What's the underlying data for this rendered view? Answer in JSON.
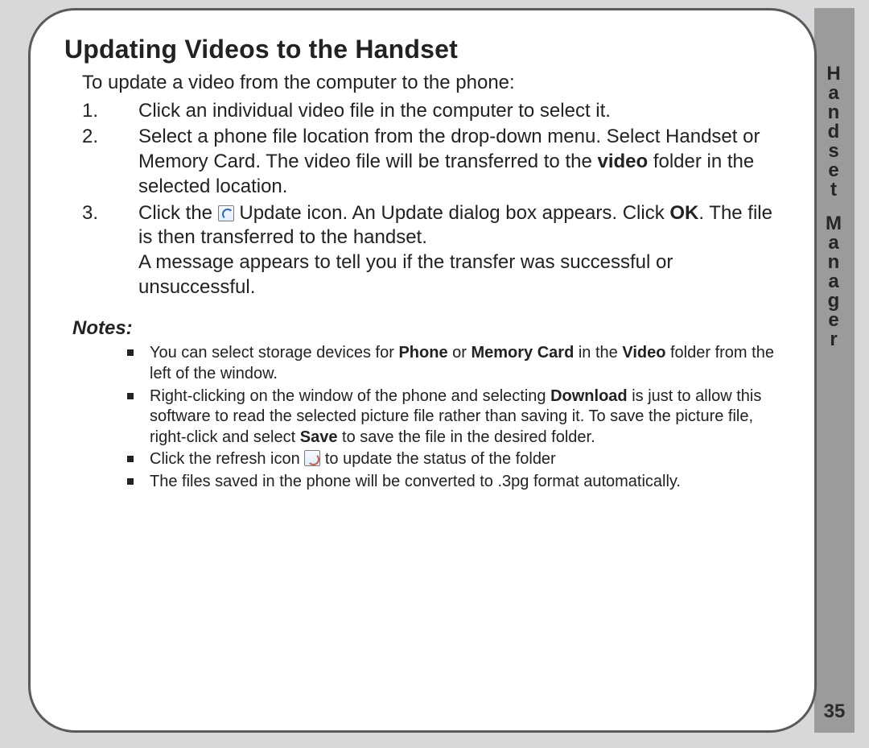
{
  "sideTab": {
    "label": "Handset Manager"
  },
  "pageNumber": "35",
  "title": "Updating Videos to the Handset",
  "intro": "To update a video from the computer to the phone:",
  "steps": {
    "s1": {
      "num": "1.",
      "text": "Click an individual video file in the computer to select it."
    },
    "s2": {
      "num": "2.",
      "a": "Select a phone file location from the drop-down menu. Select Handset or Memory Card. The video file will be transferred to the ",
      "b": "video",
      "c": " folder in the selected location."
    },
    "s3": {
      "num": "3.",
      "a": "Click the ",
      "b": " Update icon. An Update dialog box appears. Click ",
      "c": "OK",
      "d": ". The file is then transferred to the handset.",
      "e": "A message appears to tell you if the transfer was successful or unsuccessful."
    }
  },
  "notesTitle": "Notes:",
  "notes": {
    "n1": {
      "a": "You can select storage devices for ",
      "b": "Phone",
      "c": " or ",
      "d": "Memory Card",
      "e": " in the ",
      "f": "Video",
      "g": " folder from the left of the window."
    },
    "n2": {
      "a": "Right-clicking on the window of the phone and selecting ",
      "b": "Download",
      "c": " is just to allow this software to read the selected picture file rather than saving it. To save the picture file, right-click and select ",
      "d": "Save",
      "e": " to save the file in the desired folder."
    },
    "n3": {
      "a": "Click the refresh icon ",
      "b": " to update the status of the folder"
    },
    "n4": {
      "a": "The files saved in the phone will be converted to .3pg format automatically."
    }
  }
}
